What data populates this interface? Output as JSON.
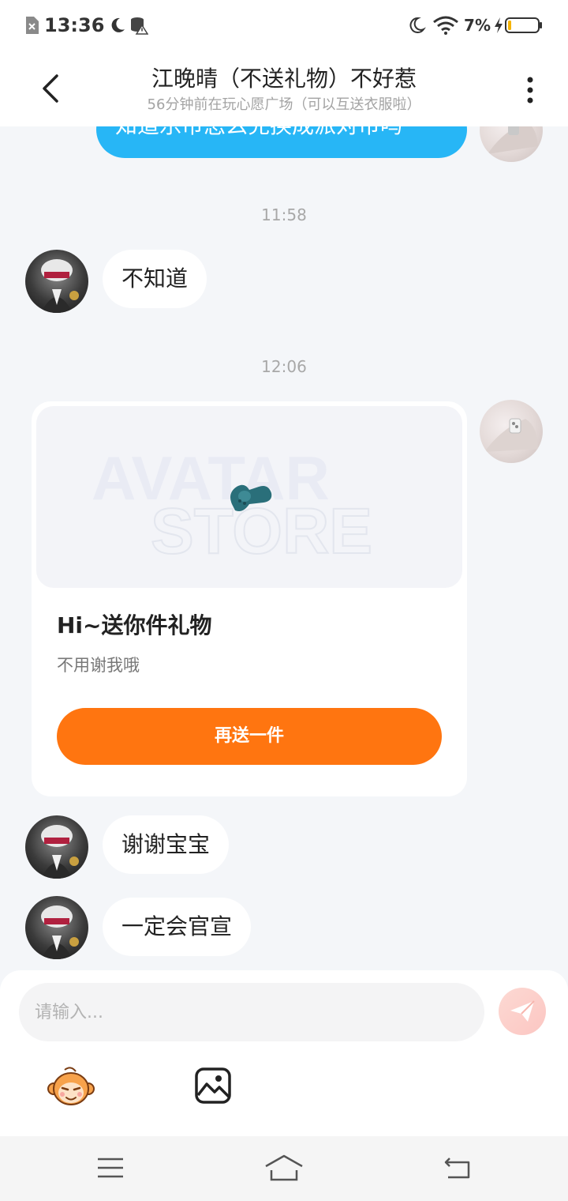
{
  "status_bar": {
    "time": "13:36",
    "battery_percent": "7%",
    "icons": [
      "no-sim-icon",
      "moon-icon",
      "database-warning-icon",
      "moon-icon",
      "wifi-icon",
      "charging-icon",
      "battery-icon"
    ]
  },
  "header": {
    "title": "江晚晴（不送礼物）不好惹",
    "subtitle": "56分钟前在玩心愿广场（可以互送衣服啦）",
    "back_icon": "back-icon",
    "more_icon": "more-icon"
  },
  "chat": {
    "partial_message": "知道乐币怎么兑换成派对币吗",
    "timestamps": [
      "11:58",
      "12:06"
    ],
    "msg_1": "不知道",
    "gift_card": {
      "watermark_line1": "AVATAR",
      "watermark_line2": "STORE",
      "title": "Hi~送你件礼物",
      "description": "不用谢我哦",
      "button_label": "再送一件"
    },
    "msg_2": "谢谢宝宝",
    "msg_3": "一定会官宣"
  },
  "input": {
    "placeholder": "请输入..."
  },
  "colors": {
    "accent_blue": "#27b6f6",
    "accent_orange": "#ff7510",
    "background": "#f4f6f9"
  }
}
